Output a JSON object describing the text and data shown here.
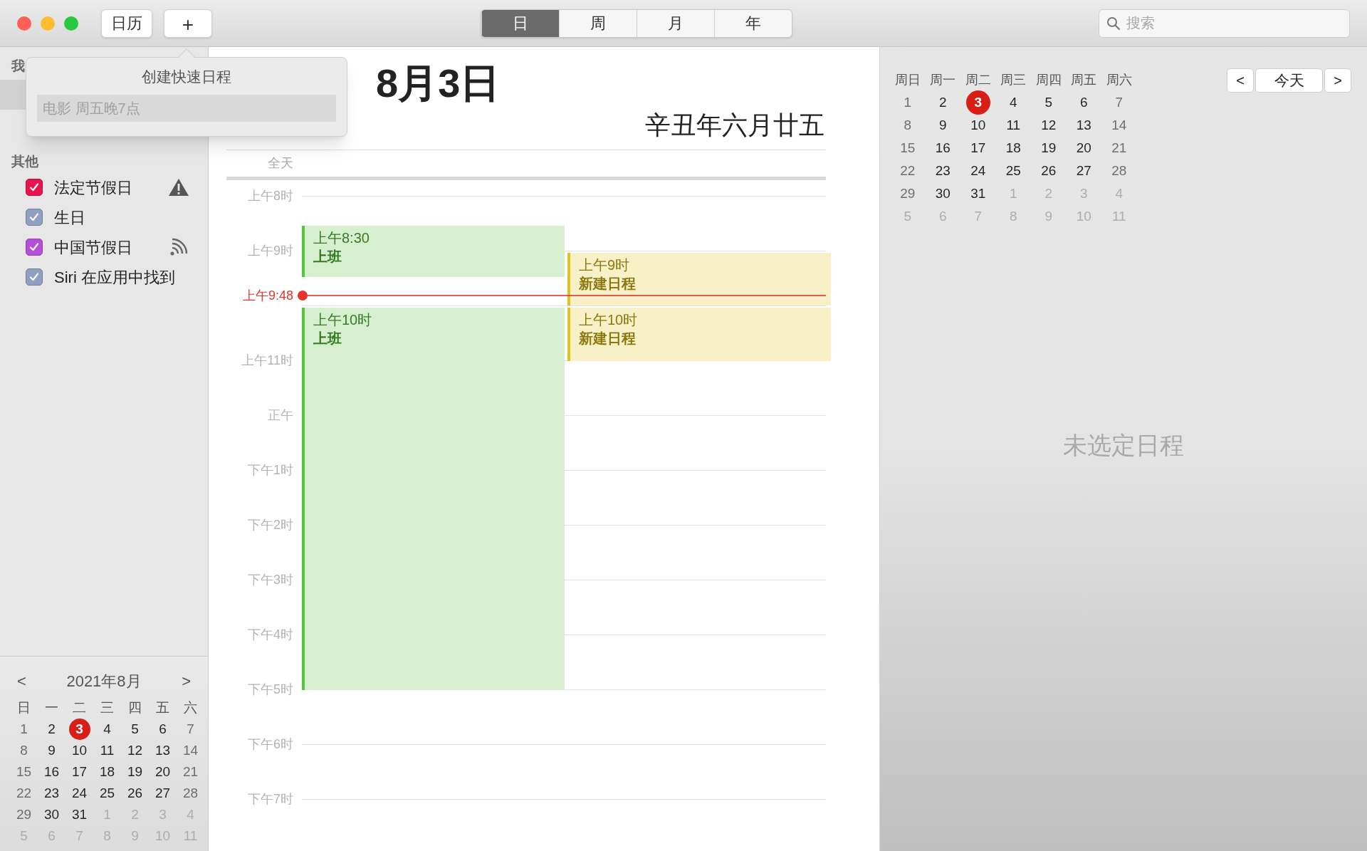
{
  "toolbar": {
    "buttons": [
      "日历",
      "+"
    ],
    "view_tabs": [
      {
        "label": "日",
        "selected": true
      },
      {
        "label": "周",
        "selected": false
      },
      {
        "label": "月",
        "selected": false
      },
      {
        "label": "年",
        "selected": false
      }
    ],
    "search": {
      "placeholder": "搜索"
    }
  },
  "popover": {
    "title": "创建快速日程",
    "placeholder": "电影 周五晚7点"
  },
  "sidebar": {
    "sections": [
      {
        "header": "我"
      },
      {
        "header": "其他",
        "items": [
          {
            "label": "法定节假日",
            "checked": true,
            "color": "#e8134f",
            "kind": "warning"
          },
          {
            "label": "生日",
            "checked": true,
            "color": "#8e9fbf",
            "kind": "plain"
          },
          {
            "label": "中国节假日",
            "checked": true,
            "color": "#b64fd8",
            "kind": "subscribed"
          },
          {
            "label": "Siri 在应用中找到",
            "checked": true,
            "color": "#8e9fbf",
            "kind": "plain"
          }
        ]
      }
    ],
    "mini_calendar": {
      "title": "2021年8月",
      "prev": "<",
      "next": ">",
      "weekdays": [
        "日",
        "一",
        "二",
        "三",
        "四",
        "五",
        "六"
      ],
      "days": [
        {
          "label": "1",
          "other_month": false,
          "selected": false
        },
        {
          "label": "2",
          "other_month": false,
          "selected": false
        },
        {
          "label": "3",
          "other_month": false,
          "selected": true
        },
        {
          "label": "4",
          "other_month": false,
          "selected": false
        },
        {
          "label": "5",
          "other_month": false,
          "selected": false
        },
        {
          "label": "6",
          "other_month": false,
          "selected": false
        },
        {
          "label": "7",
          "other_month": false,
          "selected": false
        },
        {
          "label": "8",
          "other_month": false,
          "selected": false
        },
        {
          "label": "9",
          "other_month": false,
          "selected": false
        },
        {
          "label": "10",
          "other_month": false,
          "selected": false
        },
        {
          "label": "11",
          "other_month": false,
          "selected": false
        },
        {
          "label": "12",
          "other_month": false,
          "selected": false
        },
        {
          "label": "13",
          "other_month": false,
          "selected": false
        },
        {
          "label": "14",
          "other_month": false,
          "selected": false
        },
        {
          "label": "15",
          "other_month": false,
          "selected": false
        },
        {
          "label": "16",
          "other_month": false,
          "selected": false
        },
        {
          "label": "17",
          "other_month": false,
          "selected": false
        },
        {
          "label": "18",
          "other_month": false,
          "selected": false
        },
        {
          "label": "19",
          "other_month": false,
          "selected": false
        },
        {
          "label": "20",
          "other_month": false,
          "selected": false
        },
        {
          "label": "21",
          "other_month": false,
          "selected": false
        },
        {
          "label": "22",
          "other_month": false,
          "selected": false
        },
        {
          "label": "23",
          "other_month": false,
          "selected": false
        },
        {
          "label": "24",
          "other_month": false,
          "selected": false
        },
        {
          "label": "25",
          "other_month": false,
          "selected": false
        },
        {
          "label": "26",
          "other_month": false,
          "selected": false
        },
        {
          "label": "27",
          "other_month": false,
          "selected": false
        },
        {
          "label": "28",
          "other_month": false,
          "selected": false
        },
        {
          "label": "29",
          "other_month": false,
          "selected": false
        },
        {
          "label": "30",
          "other_month": false,
          "selected": false
        },
        {
          "label": "31",
          "other_month": false,
          "selected": false
        },
        {
          "label": "1",
          "other_month": true,
          "selected": false
        },
        {
          "label": "2",
          "other_month": true,
          "selected": false
        },
        {
          "label": "3",
          "other_month": true,
          "selected": false
        },
        {
          "label": "4",
          "other_month": true,
          "selected": false
        },
        {
          "label": "5",
          "other_month": true,
          "selected": false
        },
        {
          "label": "6",
          "other_month": true,
          "selected": false
        },
        {
          "label": "7",
          "other_month": true,
          "selected": false
        },
        {
          "label": "8",
          "other_month": true,
          "selected": false
        },
        {
          "label": "9",
          "other_month": true,
          "selected": false
        },
        {
          "label": "10",
          "other_month": true,
          "selected": false
        },
        {
          "label": "11",
          "other_month": true,
          "selected": false
        }
      ]
    }
  },
  "day_view": {
    "title": "8月3日",
    "lunar": "辛丑年六月廿五",
    "all_day_label": "全天",
    "hours": [
      "上午8时",
      "上午9时",
      "上午11时",
      "正午",
      "下午1时",
      "下午2时",
      "下午3时",
      "下午4时",
      "下午5时",
      "下午6时",
      "下午7时"
    ],
    "now": {
      "label": "上午9:48"
    },
    "events": [
      {
        "time": "上午8:30",
        "title": "上班",
        "color": "#5ac43e"
      },
      {
        "time": "上午9时",
        "title": "新建日程",
        "color": "#e2c21a"
      },
      {
        "time": "上午10时",
        "title": "上班",
        "color": "#5ac43e"
      },
      {
        "time": "上午10时",
        "title": "新建日程",
        "color": "#e2c21a"
      }
    ]
  },
  "inspector": {
    "weekdays": [
      "周日",
      "周一",
      "周二",
      "周三",
      "周四",
      "周五",
      "周六"
    ],
    "days": [
      {
        "label": "1",
        "other_month": false,
        "selected": false
      },
      {
        "label": "2",
        "other_month": false,
        "selected": false
      },
      {
        "label": "3",
        "other_month": false,
        "selected": true
      },
      {
        "label": "4",
        "other_month": false,
        "selected": false
      },
      {
        "label": "5",
        "other_month": false,
        "selected": false
      },
      {
        "label": "6",
        "other_month": false,
        "selected": false
      },
      {
        "label": "7",
        "other_month": false,
        "selected": false
      },
      {
        "label": "8",
        "other_month": false,
        "selected": false
      },
      {
        "label": "9",
        "other_month": false,
        "selected": false
      },
      {
        "label": "10",
        "other_month": false,
        "selected": false
      },
      {
        "label": "11",
        "other_month": false,
        "selected": false
      },
      {
        "label": "12",
        "other_month": false,
        "selected": false
      },
      {
        "label": "13",
        "other_month": false,
        "selected": false
      },
      {
        "label": "14",
        "other_month": false,
        "selected": false
      },
      {
        "label": "15",
        "other_month": false,
        "selected": false
      },
      {
        "label": "16",
        "other_month": false,
        "selected": false
      },
      {
        "label": "17",
        "other_month": false,
        "selected": false
      },
      {
        "label": "18",
        "other_month": false,
        "selected": false
      },
      {
        "label": "19",
        "other_month": false,
        "selected": false
      },
      {
        "label": "20",
        "other_month": false,
        "selected": false
      },
      {
        "label": "21",
        "other_month": false,
        "selected": false
      },
      {
        "label": "22",
        "other_month": false,
        "selected": false
      },
      {
        "label": "23",
        "other_month": false,
        "selected": false
      },
      {
        "label": "24",
        "other_month": false,
        "selected": false
      },
      {
        "label": "25",
        "other_month": false,
        "selected": false
      },
      {
        "label": "26",
        "other_month": false,
        "selected": false
      },
      {
        "label": "27",
        "other_month": false,
        "selected": false
      },
      {
        "label": "28",
        "other_month": false,
        "selected": false
      },
      {
        "label": "29",
        "other_month": false,
        "selected": false
      },
      {
        "label": "30",
        "other_month": false,
        "selected": false
      },
      {
        "label": "31",
        "other_month": false,
        "selected": false
      },
      {
        "label": "1",
        "other_month": true,
        "selected": false
      },
      {
        "label": "2",
        "other_month": true,
        "selected": false
      },
      {
        "label": "3",
        "other_month": true,
        "selected": false
      },
      {
        "label": "4",
        "other_month": true,
        "selected": false
      },
      {
        "label": "5",
        "other_month": true,
        "selected": false
      },
      {
        "label": "6",
        "other_month": true,
        "selected": false
      },
      {
        "label": "7",
        "other_month": true,
        "selected": false
      },
      {
        "label": "8",
        "other_month": true,
        "selected": false
      },
      {
        "label": "9",
        "other_month": true,
        "selected": false
      },
      {
        "label": "10",
        "other_month": true,
        "selected": false
      },
      {
        "label": "11",
        "other_month": true,
        "selected": false
      }
    ],
    "prev": "<",
    "today_button": "今天",
    "next": ">",
    "empty_text": "未选定日程"
  }
}
